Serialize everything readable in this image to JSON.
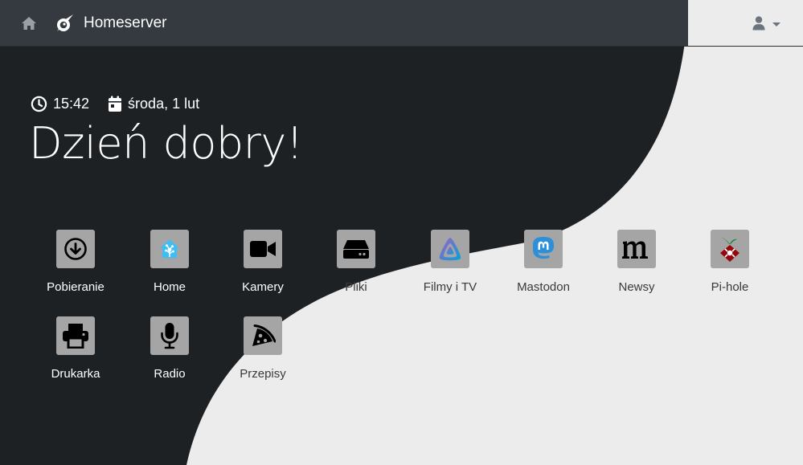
{
  "navbar": {
    "brand": "Homeserver",
    "home_icon": "home-icon",
    "logo_icon": "comet-logo-icon",
    "user_icon": "user-icon",
    "colors": {
      "background": "#343a40",
      "brand_text": "#ffffff",
      "user_icon": "#6c757d"
    }
  },
  "hero": {
    "time": "15:42",
    "date": "środa, 1 lut",
    "greeting": "Dzień dobry!",
    "clock_icon": "clock-icon",
    "calendar_icon": "calendar-icon"
  },
  "theme": {
    "dark": "#1e2124",
    "light": "#ececec",
    "tile_bg": "#a5a5a5"
  },
  "apps": [
    {
      "label": "Pobieranie",
      "icon": "download-circle-icon"
    },
    {
      "label": "Home",
      "icon": "home-assistant-icon"
    },
    {
      "label": "Kamery",
      "icon": "video-camera-icon"
    },
    {
      "label": "Pliki",
      "icon": "hard-drive-icon"
    },
    {
      "label": "Filmy i TV",
      "icon": "jellyfin-icon"
    },
    {
      "label": "Mastodon",
      "icon": "mastodon-icon"
    },
    {
      "label": "Newsy",
      "icon": "miniflux-icon"
    },
    {
      "label": "Pi-hole",
      "icon": "pi-hole-icon"
    },
    {
      "label": "Drukarka",
      "icon": "printer-icon"
    },
    {
      "label": "Radio",
      "icon": "microphone-icon"
    },
    {
      "label": "Przepisy",
      "icon": "pizza-icon"
    }
  ]
}
